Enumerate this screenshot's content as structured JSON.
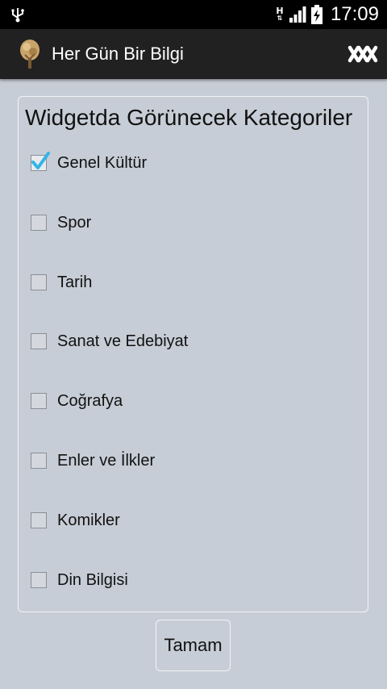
{
  "status_bar": {
    "time": "17:09",
    "network_label": "H",
    "icons": [
      "usb-icon",
      "network-type-icon",
      "signal-icon",
      "battery-charging-icon"
    ]
  },
  "action_bar": {
    "title": "Her Gün Bir Bilgi",
    "app_icon": "tree-icon",
    "close_icon": "close-icon"
  },
  "card": {
    "title": "Widgetda Görünecek Kategoriler",
    "options": [
      {
        "label": "Genel Kültür",
        "checked": true
      },
      {
        "label": "Spor",
        "checked": false
      },
      {
        "label": "Tarih",
        "checked": false
      },
      {
        "label": "Sanat ve Edebiyat",
        "checked": false
      },
      {
        "label": "Coğrafya",
        "checked": false
      },
      {
        "label": "Enler ve İlkler",
        "checked": false
      },
      {
        "label": "Komikler",
        "checked": false
      },
      {
        "label": "Din Bilgisi",
        "checked": false
      }
    ]
  },
  "ok_button": {
    "label": "Tamam"
  },
  "colors": {
    "background": "#c7cdd6",
    "action_bar": "#212121",
    "status_bar": "#000000",
    "check_accent": "#33b5e5"
  }
}
